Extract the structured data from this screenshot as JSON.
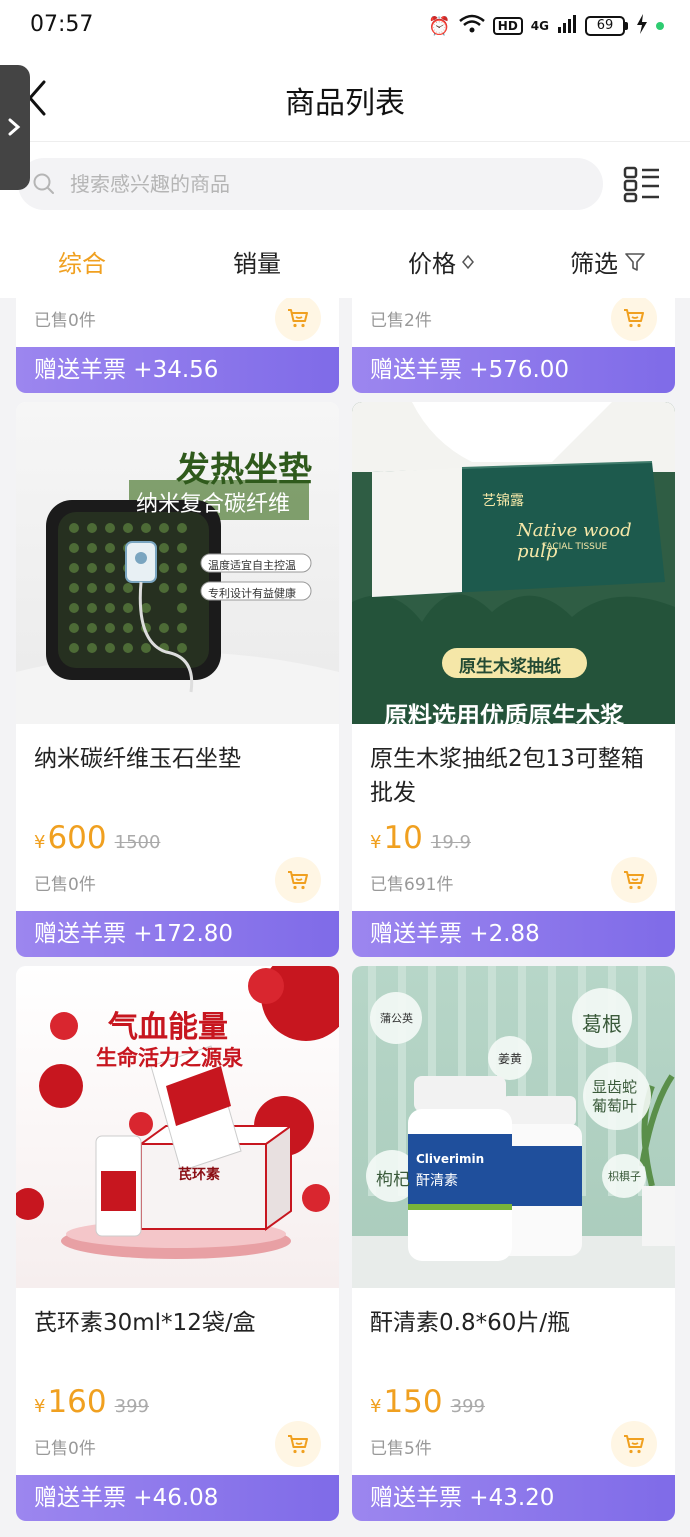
{
  "status": {
    "time": "07:57",
    "net": "4G",
    "hd": "HD",
    "battery": "69"
  },
  "header": {
    "title": "商品列表"
  },
  "search": {
    "placeholder": "搜索感兴趣的商品"
  },
  "sort_tabs": [
    {
      "label": "综合",
      "active": true
    },
    {
      "label": "销量"
    },
    {
      "label": "价格"
    },
    {
      "label": "筛选"
    }
  ],
  "top_partial": [
    {
      "sold": "已售0件",
      "reward": "赠送羊票 +34.56"
    },
    {
      "sold": "已售2件",
      "reward": "赠送羊票 +576.00"
    }
  ],
  "products": [
    {
      "title": "纳米碳纤维玉石坐垫",
      "price_symbol": "¥",
      "price": "600",
      "orig_price": "1500",
      "sold": "已售0件",
      "reward": "赠送羊票 +172.80",
      "img_headline": "发热坐垫",
      "img_sub": "纳米复合碳纤维",
      "img_tags": [
        "温度适宜自主控温",
        "专利设计有益健康"
      ]
    },
    {
      "title": "原生木浆抽纸2包13可整箱批发",
      "price_symbol": "¥",
      "price": "10",
      "orig_price": "19.9",
      "sold": "已售691件",
      "reward": "赠送羊票 +2.88",
      "img_brand": "艺锦露",
      "img_script": "Native wood pulp",
      "img_facial": "FACIAL TISSUE",
      "img_badge": "原生木浆抽纸",
      "img_bottom": "原料选用优质原生木浆"
    },
    {
      "title": "芪环素30ml*12袋/盒",
      "price_symbol": "¥",
      "price": "160",
      "orig_price": "399",
      "sold": "已售0件",
      "reward": "赠送羊票 +46.08",
      "img_headline": "气血能量",
      "img_sub": "生命活力之源泉",
      "img_box": "芪环素"
    },
    {
      "title": "酐清素0.8*60片/瓶",
      "price_symbol": "¥",
      "price": "150",
      "orig_price": "399",
      "sold": "已售5件",
      "reward": "赠送羊票 +43.20",
      "img_labels": [
        "蒲公英",
        "姜黄",
        "葛根",
        "显齿蛇葡萄叶",
        "枸杞",
        "枳椇子"
      ],
      "img_bottle": "Cliverimin",
      "img_bottle_cn": "酐清素"
    }
  ],
  "colors": {
    "accent": "#f0a020",
    "reward_bar": "#8f7bee",
    "cart_bg": "#fff6e4"
  }
}
